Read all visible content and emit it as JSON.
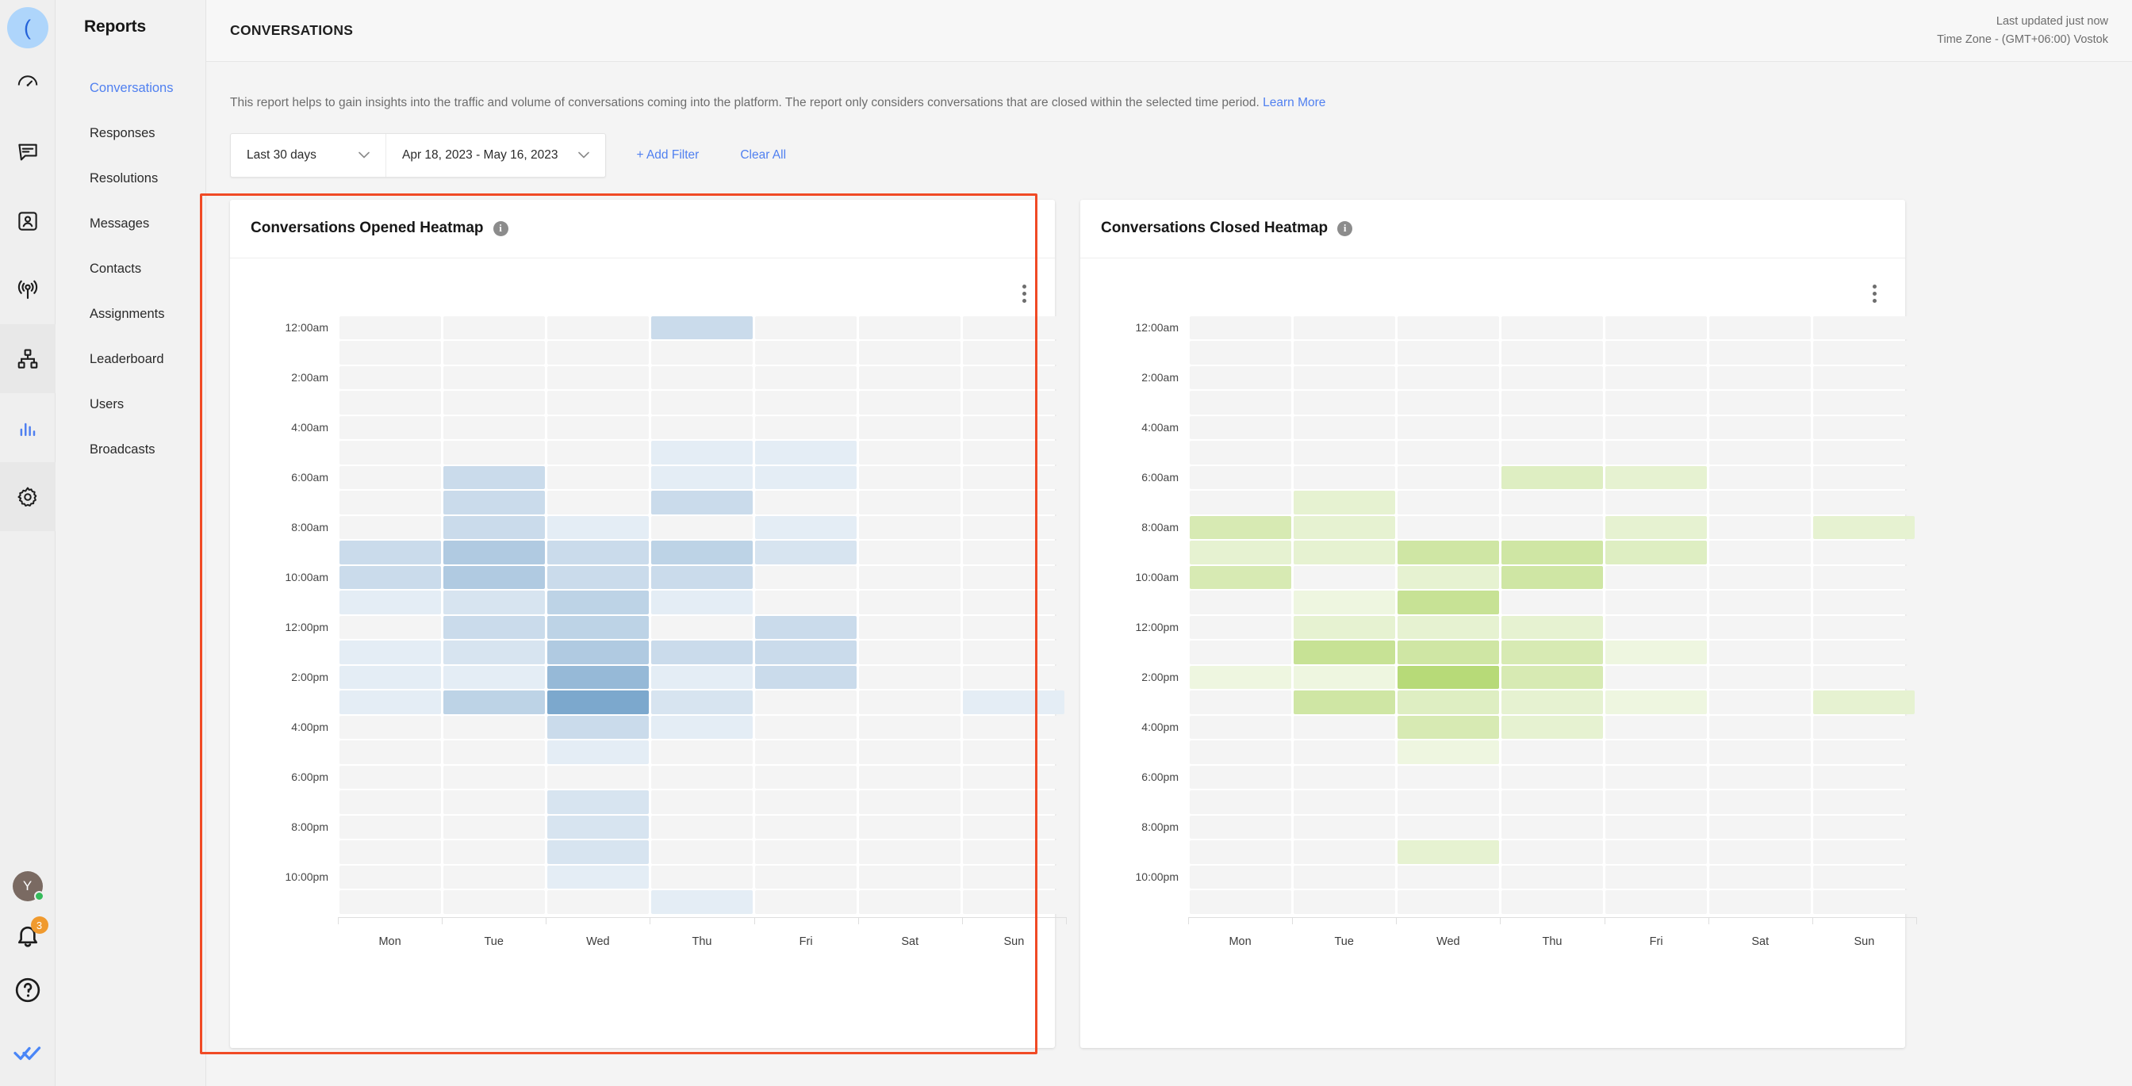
{
  "rail": {
    "logo_glyph": "(",
    "items": [
      {
        "name": "dashboard-icon",
        "label": "Dashboard"
      },
      {
        "name": "conversations-icon",
        "label": "Conversations"
      },
      {
        "name": "contacts-icon",
        "label": "Contacts"
      },
      {
        "name": "broadcasts-icon",
        "label": "Broadcasts"
      },
      {
        "name": "automation-icon",
        "label": "Automation"
      },
      {
        "name": "reports-icon",
        "label": "Reports"
      },
      {
        "name": "settings-icon",
        "label": "Settings"
      }
    ],
    "avatar_initial": "Y",
    "notification_count": "3"
  },
  "sidebar": {
    "title": "Reports",
    "items": [
      {
        "label": "Conversations",
        "active": true
      },
      {
        "label": "Responses",
        "active": false
      },
      {
        "label": "Resolutions",
        "active": false
      },
      {
        "label": "Messages",
        "active": false
      },
      {
        "label": "Contacts",
        "active": false
      },
      {
        "label": "Assignments",
        "active": false
      },
      {
        "label": "Leaderboard",
        "active": false
      },
      {
        "label": "Users",
        "active": false
      },
      {
        "label": "Broadcasts",
        "active": false
      }
    ]
  },
  "topbar": {
    "title": "CONVERSATIONS",
    "last_updated": "Last updated just now",
    "timezone": "Time Zone - (GMT+06:00) Vostok"
  },
  "description": {
    "text": "This report helps to gain insights into the traffic and volume of conversations coming into the platform. The report only considers conversations that are closed within the selected time period. ",
    "link_label": "Learn More"
  },
  "filters": {
    "range_preset": "Last 30 days",
    "date_range": "Apr 18, 2023 - May 16, 2023",
    "add_filter_label": "+ Add Filter",
    "clear_all_label": "Clear All",
    "chevron": "⌄"
  },
  "colors": {
    "accent_blue": "#5080f0",
    "highlight_red": "#f04a25",
    "heatmap_blue": "#6f9fc8",
    "heatmap_green": "#a7d25a",
    "empty_cell": "#f4f4f4",
    "badge_orange": "#f09a2e",
    "status_green": "#35bb5b"
  },
  "cards": [
    {
      "title": "Conversations Opened Heatmap",
      "info_glyph": "i",
      "highlighted": true
    },
    {
      "title": "Conversations Closed Heatmap",
      "info_glyph": "i",
      "highlighted": false
    }
  ],
  "chart_data": [
    {
      "type": "heatmap",
      "title": "Conversations Opened Heatmap",
      "xlabel": "",
      "ylabel": "",
      "categories": [
        "Mon",
        "Tue",
        "Wed",
        "Thu",
        "Fri",
        "Sat",
        "Sun"
      ],
      "y_tick_labels": [
        "12:00am",
        "2:00am",
        "4:00am",
        "6:00am",
        "8:00am",
        "10:00am",
        "12:00pm",
        "2:00pm",
        "4:00pm",
        "6:00pm",
        "8:00pm",
        "10:00pm"
      ],
      "rows": [
        "12:00am",
        "1:00am",
        "2:00am",
        "3:00am",
        "4:00am",
        "5:00am",
        "6:00am",
        "7:00am",
        "8:00am",
        "9:00am",
        "10:00am",
        "11:00am",
        "12:00pm",
        "1:00pm",
        "2:00pm",
        "3:00pm",
        "4:00pm",
        "5:00pm",
        "6:00pm",
        "7:00pm",
        "8:00pm",
        "9:00pm",
        "10:00pm",
        "11:00pm"
      ],
      "color_scale": "#6f9fc8",
      "zmax": 10,
      "values": [
        [
          0,
          0,
          0,
          3,
          0,
          0,
          0
        ],
        [
          0,
          0,
          0,
          0,
          0,
          0,
          0
        ],
        [
          0,
          0,
          0,
          0,
          0,
          0,
          0
        ],
        [
          0,
          0,
          0,
          0,
          0,
          0,
          0
        ],
        [
          0,
          0,
          0,
          0,
          0,
          0,
          0
        ],
        [
          0,
          0,
          0,
          1,
          1,
          0,
          0
        ],
        [
          0,
          3,
          0,
          1,
          1,
          0,
          0
        ],
        [
          0,
          3,
          0,
          3,
          0,
          0,
          0
        ],
        [
          0,
          3,
          1,
          0,
          1,
          0,
          0
        ],
        [
          3,
          5,
          3,
          4,
          2,
          0,
          0
        ],
        [
          3,
          5,
          3,
          3,
          0,
          0,
          0
        ],
        [
          1,
          2,
          4,
          1,
          0,
          0,
          0
        ],
        [
          0,
          3,
          4,
          0,
          3,
          0,
          0
        ],
        [
          1,
          2,
          5,
          3,
          3,
          0,
          0
        ],
        [
          1,
          1,
          7,
          1,
          3,
          0,
          0
        ],
        [
          1,
          4,
          9,
          2,
          0,
          0,
          1
        ],
        [
          0,
          0,
          3,
          1,
          0,
          0,
          0
        ],
        [
          0,
          0,
          1,
          0,
          0,
          0,
          0
        ],
        [
          0,
          0,
          0,
          0,
          0,
          0,
          0
        ],
        [
          0,
          0,
          2,
          0,
          0,
          0,
          0
        ],
        [
          0,
          0,
          2,
          0,
          0,
          0,
          0
        ],
        [
          0,
          0,
          2,
          0,
          0,
          0,
          0
        ],
        [
          0,
          0,
          1,
          0,
          0,
          0,
          0
        ],
        [
          0,
          0,
          0,
          1,
          0,
          0,
          0
        ]
      ]
    },
    {
      "type": "heatmap",
      "title": "Conversations Closed Heatmap",
      "xlabel": "",
      "ylabel": "",
      "categories": [
        "Mon",
        "Tue",
        "Wed",
        "Thu",
        "Fri",
        "Sat",
        "Sun"
      ],
      "y_tick_labels": [
        "12:00am",
        "2:00am",
        "4:00am",
        "6:00am",
        "8:00am",
        "10:00am",
        "12:00pm",
        "2:00pm",
        "4:00pm",
        "6:00pm",
        "8:00pm",
        "10:00pm"
      ],
      "rows": [
        "12:00am",
        "1:00am",
        "2:00am",
        "3:00am",
        "4:00am",
        "5:00am",
        "6:00am",
        "7:00am",
        "8:00am",
        "9:00am",
        "10:00am",
        "11:00am",
        "12:00pm",
        "1:00pm",
        "2:00pm",
        "3:00pm",
        "4:00pm",
        "5:00pm",
        "6:00pm",
        "7:00pm",
        "8:00pm",
        "9:00pm",
        "10:00pm",
        "11:00pm"
      ],
      "color_scale": "#a7d25a",
      "zmax": 10,
      "values": [
        [
          0,
          0,
          0,
          0,
          0,
          0,
          0
        ],
        [
          0,
          0,
          0,
          0,
          0,
          0,
          0
        ],
        [
          0,
          0,
          0,
          0,
          0,
          0,
          0
        ],
        [
          0,
          0,
          0,
          0,
          0,
          0,
          0
        ],
        [
          0,
          0,
          0,
          0,
          0,
          0,
          0
        ],
        [
          0,
          0,
          0,
          0,
          0,
          0,
          0
        ],
        [
          0,
          0,
          0,
          3,
          2,
          0,
          0
        ],
        [
          0,
          2,
          0,
          0,
          0,
          0,
          0
        ],
        [
          4,
          2,
          0,
          0,
          2,
          0,
          2
        ],
        [
          2,
          2,
          5,
          5,
          3,
          0,
          0
        ],
        [
          4,
          0,
          2,
          5,
          0,
          0,
          0
        ],
        [
          0,
          1,
          6,
          0,
          0,
          0,
          0
        ],
        [
          0,
          2,
          2,
          2,
          0,
          0,
          0
        ],
        [
          0,
          6,
          5,
          4,
          1,
          0,
          0
        ],
        [
          1,
          1,
          8,
          4,
          0,
          0,
          0
        ],
        [
          0,
          5,
          3,
          2,
          1,
          0,
          2
        ],
        [
          0,
          0,
          4,
          2,
          0,
          0,
          0
        ],
        [
          0,
          0,
          1,
          0,
          0,
          0,
          0
        ],
        [
          0,
          0,
          0,
          0,
          0,
          0,
          0
        ],
        [
          0,
          0,
          0,
          0,
          0,
          0,
          0
        ],
        [
          0,
          0,
          0,
          0,
          0,
          0,
          0
        ],
        [
          0,
          0,
          2,
          0,
          0,
          0,
          0
        ],
        [
          0,
          0,
          0,
          0,
          0,
          0,
          0
        ],
        [
          0,
          0,
          0,
          0,
          0,
          0,
          0
        ]
      ]
    }
  ]
}
